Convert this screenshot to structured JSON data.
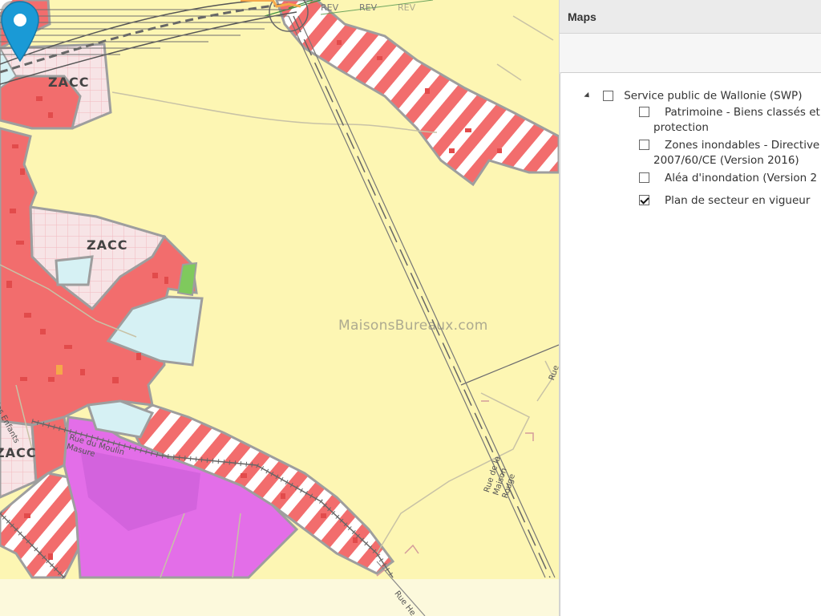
{
  "map": {
    "zone_labels": [
      "ZACC",
      "ZACC",
      "ZACC"
    ],
    "revision_labels": [
      "REV",
      "REV",
      "REV"
    ],
    "street_labels": [
      "Rue des Enfants",
      "Rue du Moulin Masure",
      "Rue de la Maison Rouge",
      "Rue He",
      "Rue"
    ],
    "watermark": "MaisonsBureaux.com",
    "marker_icon": "map-pin-icon",
    "colors": {
      "agricultural": "#fdf6b3",
      "residential": "#f26d6d",
      "residential_hatch_stripe": "#ffffff",
      "industrial": "#e36ee8",
      "zacc": "#f7dfe3",
      "public_services": "#d6f1f4",
      "green": "#7fc95d",
      "marker": "#1a9ad6"
    }
  },
  "panel": {
    "title": "Maps",
    "tree": {
      "root": {
        "label": "Service public de Wallonie (SWP)",
        "checked": false,
        "expanded": true
      },
      "children": [
        {
          "label_line1": "Patrimoine - Biens classés et",
          "label_line2": "protection",
          "checked": false
        },
        {
          "label_line1": "Zones inondables - Directive",
          "label_line2": "2007/60/CE (Version 2016)",
          "checked": false
        },
        {
          "label_line1": "Aléa d'inondation (Version 2",
          "label_line2": "",
          "checked": false
        },
        {
          "label_line1": "Plan de secteur en vigueur",
          "label_line2": "",
          "checked": true
        }
      ]
    }
  }
}
